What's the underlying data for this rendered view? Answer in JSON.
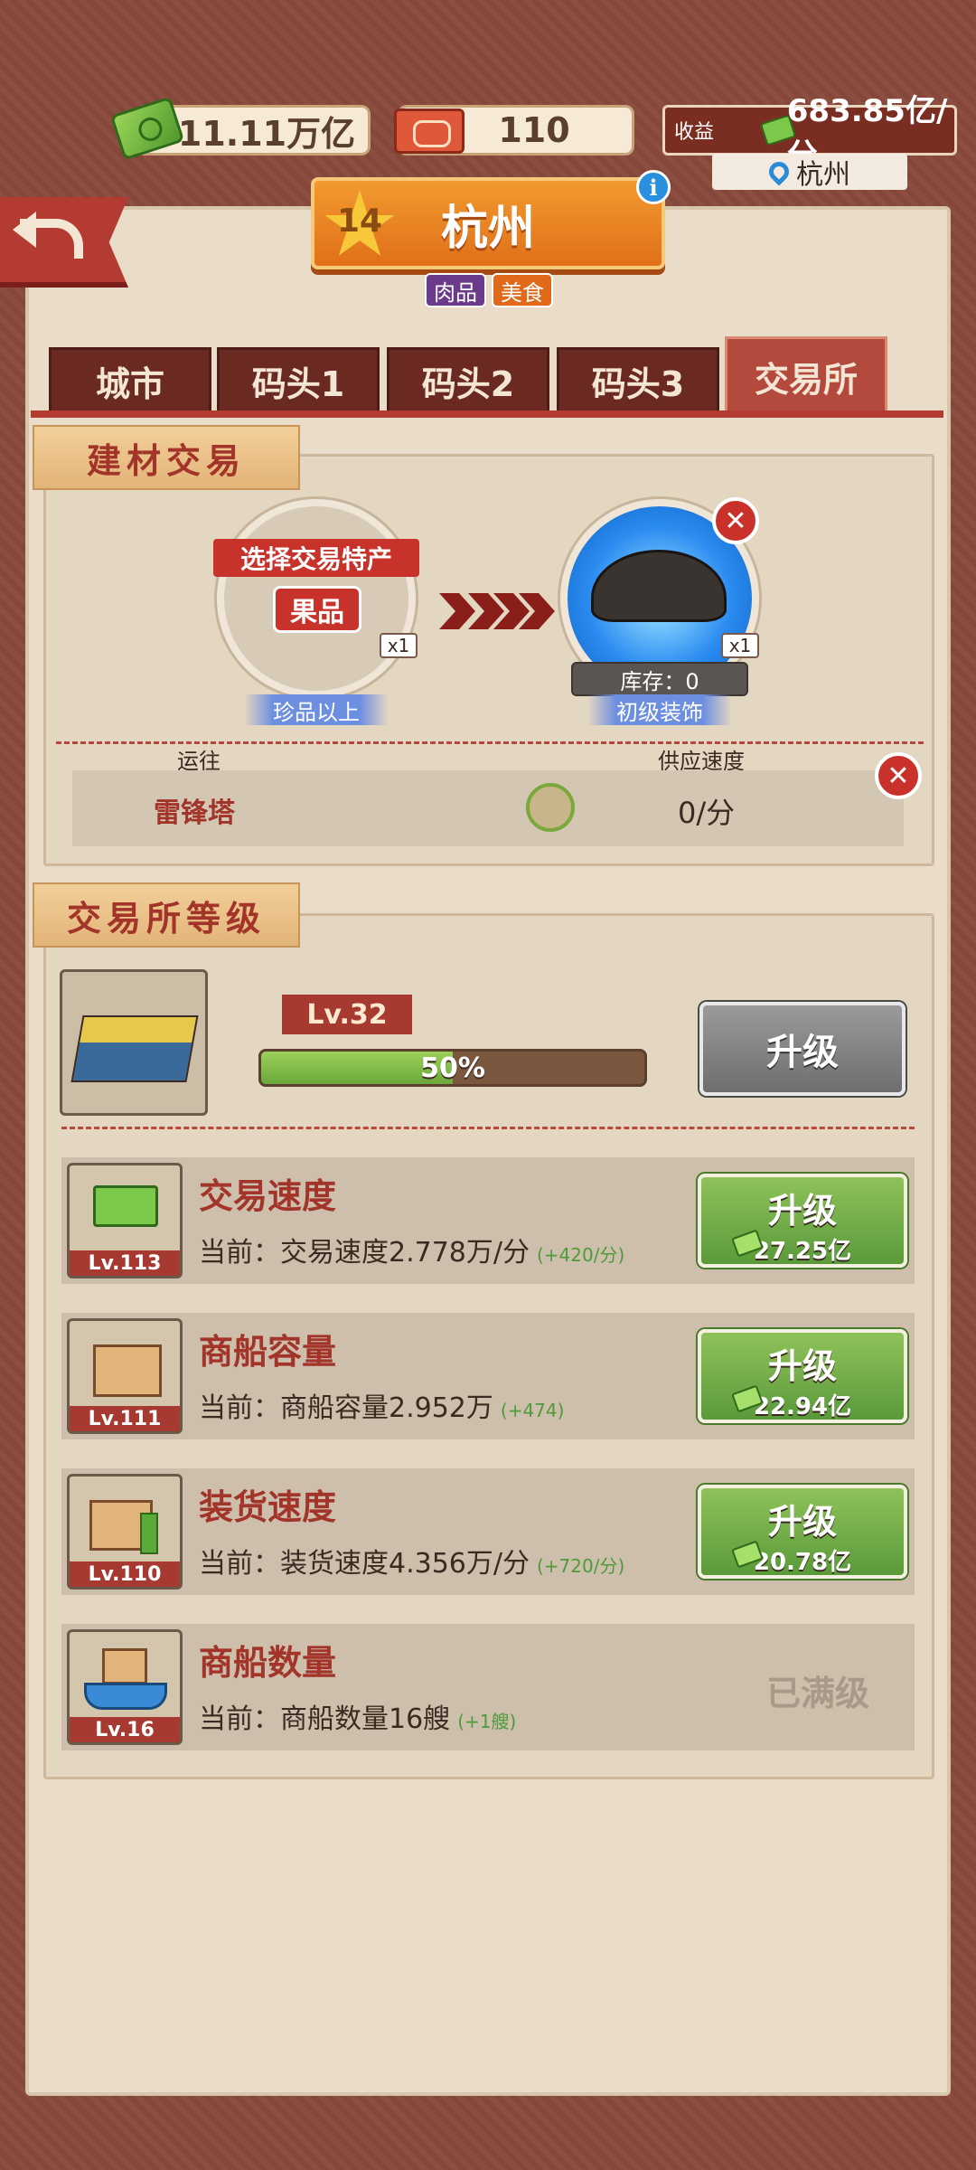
{
  "top_bar": {
    "cash": "11.11万亿",
    "tickets": "110",
    "income_label": "收益",
    "income_value": "683.85亿/分",
    "location": "杭州"
  },
  "city": {
    "level": "14",
    "name": "杭州",
    "tags": [
      "肉品",
      "美食"
    ],
    "tag_colors": [
      "#6b3a8a",
      "#e06a1a"
    ]
  },
  "tabs": [
    "城市",
    "码头1",
    "码头2",
    "码头3",
    "交易所"
  ],
  "active_tab": "交易所",
  "trade": {
    "section_title": "建材交易",
    "select_label": "选择交易特产",
    "product": "果品",
    "product_qty": "x1",
    "product_quality": "珍品以上",
    "target_qty": "x1",
    "stock": "库存：0",
    "target_quality": "初级装饰",
    "destination_label": "运往",
    "speed_label": "供应速度",
    "destination": "雷锋塔",
    "speed": "0/分"
  },
  "exchange": {
    "section_title": "交易所等级",
    "level": "Lv.32",
    "progress_text": "50%",
    "progress": 0.5,
    "upgrade_label": "升级"
  },
  "upgrades": [
    {
      "title": "交易速度",
      "level": "Lv.113",
      "desc": "当前：交易速度2.778万/分",
      "bonus": "(+420/分)",
      "button": "升级",
      "cost": "27.25亿"
    },
    {
      "title": "商船容量",
      "level": "Lv.111",
      "desc": "当前：商船容量2.952万",
      "bonus": "(+474)",
      "button": "升级",
      "cost": "22.94亿"
    },
    {
      "title": "装货速度",
      "level": "Lv.110",
      "desc": "当前：装货速度4.356万/分",
      "bonus": "(+720/分)",
      "button": "升级",
      "cost": "20.78亿"
    },
    {
      "title": "商船数量",
      "level": "Lv.16",
      "desc": "当前：商船数量16艘",
      "bonus": "(+1艘)",
      "maxed": "已满级"
    }
  ]
}
